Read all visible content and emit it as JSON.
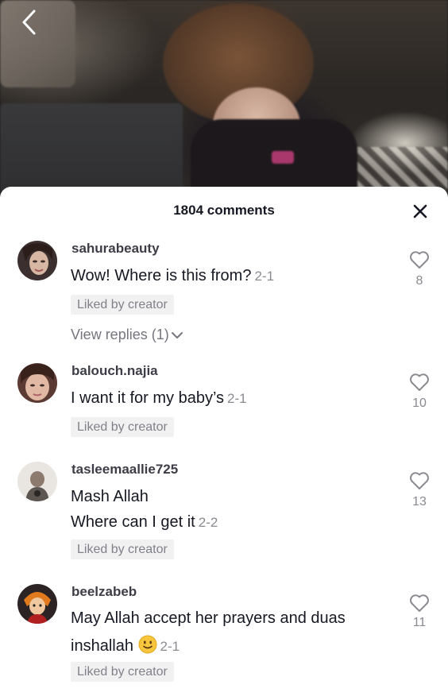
{
  "header": {
    "comment_count": "1804 comments"
  },
  "icons": {
    "back": "chevron-left-icon",
    "close": "close-icon",
    "like": "heart-outline-icon",
    "expand": "chevron-down-icon",
    "emoji": "slightly-smiling-face-emoji"
  },
  "comments": [
    {
      "username": "sahurabeauty",
      "lines": [
        "Wow! Where is this from?"
      ],
      "date": "2-1",
      "liked_by_creator": "Liked by creator",
      "likes": "8",
      "view_replies": "View replies (1)"
    },
    {
      "username": "balouch.najia",
      "lines": [
        "I want it for my baby’s"
      ],
      "date": "2-1",
      "liked_by_creator": "Liked by creator",
      "likes": "10"
    },
    {
      "username": "tasleemaallie725",
      "lines": [
        "Mash Allah",
        "Where can I get it"
      ],
      "date": "2-2",
      "liked_by_creator": "Liked by creator",
      "likes": "13"
    },
    {
      "username": "beelzabeb",
      "lines": [
        "May Allah accept her prayers and duas",
        "inshallah"
      ],
      "date": "2-1",
      "liked_by_creator": "Liked by creator",
      "likes": "11"
    }
  ]
}
